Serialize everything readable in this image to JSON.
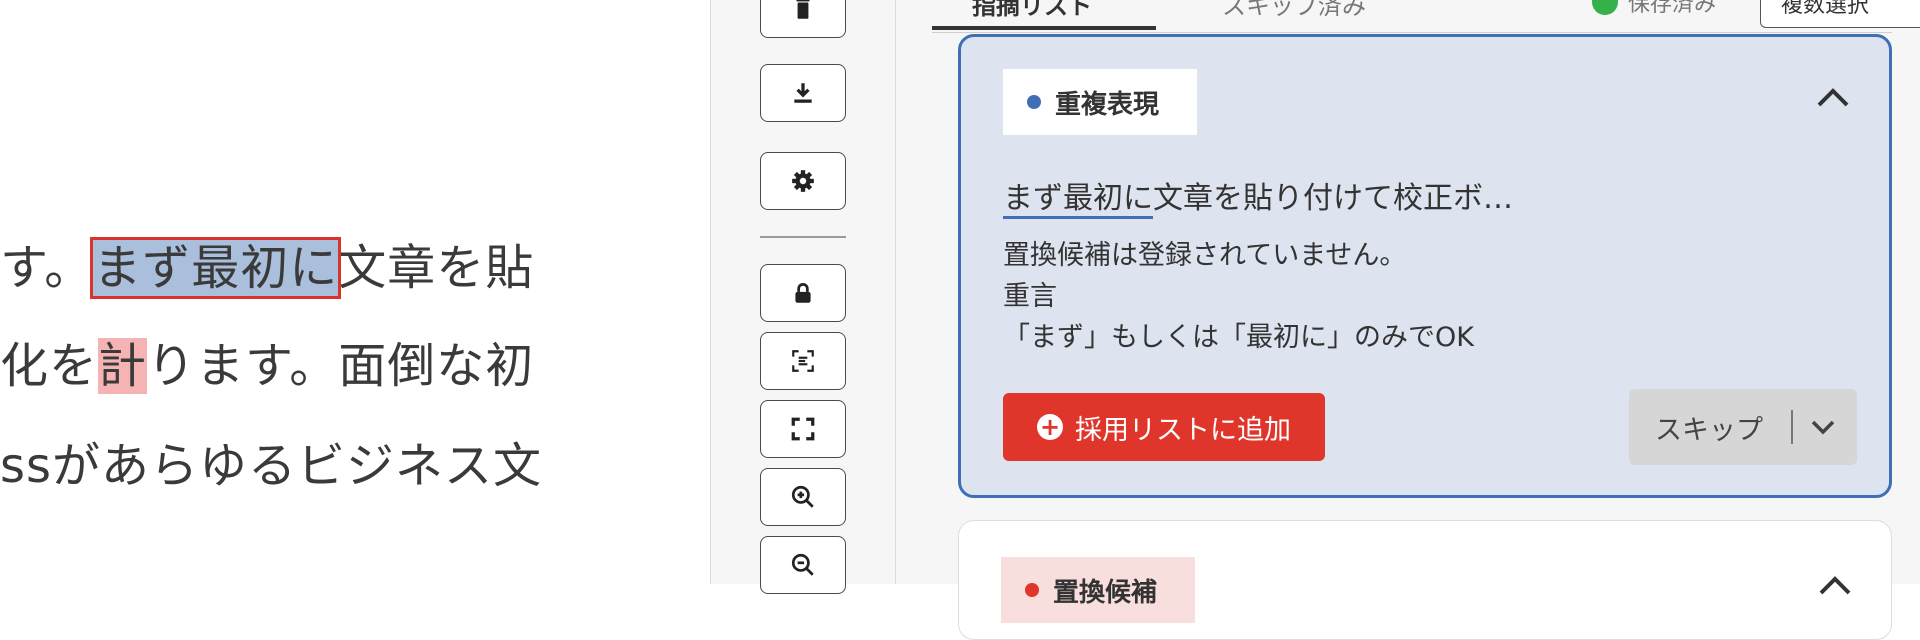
{
  "document": {
    "line1": {
      "before": "す。",
      "highlight": "まず最初に",
      "after": "文章を貼"
    },
    "line2": {
      "before": "化を",
      "highlight": "計",
      "after": "ります。面倒な初"
    },
    "line3": {
      "text": "ssがあらゆるビジネス文"
    }
  },
  "toolbar": {
    "buttons": [
      "trash-icon",
      "download-icon",
      "gear-icon",
      "lock-icon",
      "scan-text-icon",
      "fullscreen-icon",
      "zoom-in-icon",
      "zoom-out-icon"
    ]
  },
  "panel": {
    "tabs": [
      {
        "label": "指摘リスト"
      },
      {
        "label": "スキップ済み"
      }
    ],
    "saved_label": "保存済み",
    "multi_select_label": "複数選択",
    "card": {
      "category": "重複表現",
      "category_color": "#3f6fb5",
      "snippet_highlight": "まず最初に",
      "snippet_rest": "文章を貼り付けて校正ボ…",
      "message_lines": [
        "置換候補は登録されていません。",
        "重言",
        "「まず」もしくは「最初に」のみでOK"
      ],
      "add_button": "採用リストに追加",
      "skip_button": "スキップ"
    },
    "card2": {
      "category": "置換候補",
      "category_color": "#e0352b"
    }
  }
}
